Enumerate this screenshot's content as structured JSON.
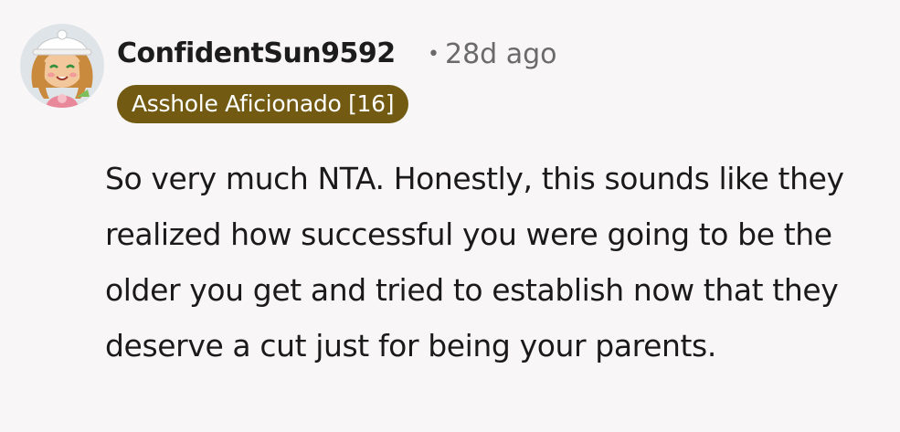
{
  "comment": {
    "avatar_icon": "user-avatar-icon",
    "username": "ConfidentSun9592",
    "separator": "•",
    "timestamp": "28d ago",
    "flair": "Asshole Aficionado [16]",
    "flair_color": "#735a12",
    "text": "So very much NTA. Honestly, this sounds like they realized how successful you were going to be the older you get and tried to establish now that they deserve a cut just for being your parents."
  }
}
